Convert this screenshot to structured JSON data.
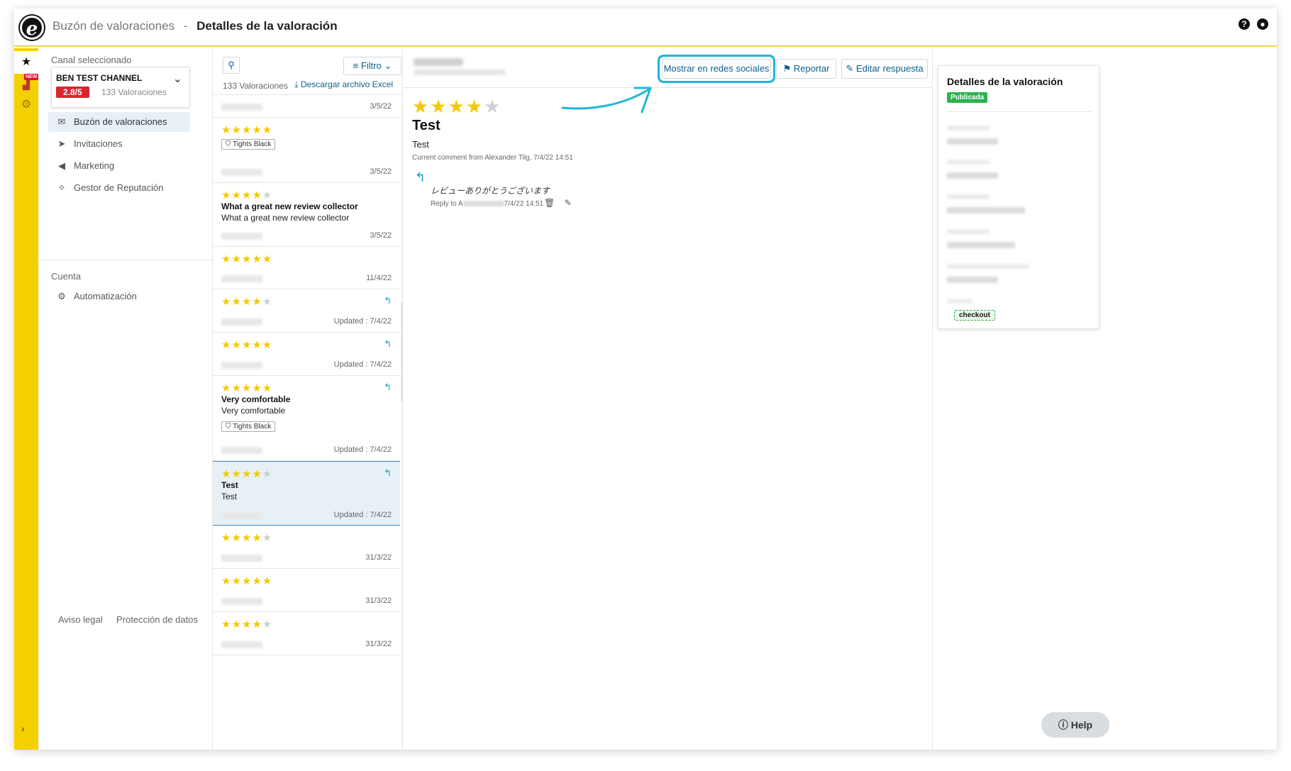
{
  "header": {
    "logo_letter": "e",
    "breadcrumb_parent": "Buzón de valoraciones",
    "breadcrumb_separator": "-",
    "breadcrumb_current": "Detalles de la valoración",
    "help_icon": "question-circle-icon",
    "user_icon": "user-circle-icon"
  },
  "rail": {
    "new_badge": "NEW",
    "items": [
      {
        "icon": "star-icon",
        "active": true
      },
      {
        "icon": "chart-new-icon",
        "active": false
      },
      {
        "icon": "gear-icon",
        "active": false
      }
    ]
  },
  "sidebar": {
    "channel_label": "Canal seleccionado",
    "channel_name": "BEN TEST CHANNEL",
    "rating": "2.8/5",
    "rating_count": "133 Valoraciones",
    "nav": [
      {
        "label": "Buzón de valoraciones",
        "icon": "inbox-icon",
        "active": true
      },
      {
        "label": "Invitaciones",
        "icon": "send-icon",
        "active": false
      },
      {
        "label": "Marketing",
        "icon": "megaphone-icon",
        "active": false
      },
      {
        "label": "Gestor de Reputación",
        "icon": "sparkle-icon",
        "active": false
      }
    ],
    "account_label": "Cuenta",
    "account_nav": [
      {
        "label": "Automatización",
        "icon": "robot-icon"
      }
    ],
    "footer_legal": "Aviso legal",
    "footer_privacy": "Protección de datos"
  },
  "list": {
    "filter_label": "Filtro",
    "count": "133 Valoraciones",
    "excel_label": "Descargar archivo Excel",
    "reviews": [
      {
        "stars": 0,
        "title": "",
        "body": "",
        "tag": "",
        "date": "3/5/22",
        "replied": false
      },
      {
        "stars": 5,
        "title": "",
        "body": "",
        "tag": "Tights Black",
        "date": "3/5/22",
        "replied": false
      },
      {
        "stars": 4,
        "title": "What a great new review collector",
        "body": "What a great new review collector",
        "tag": "",
        "date": "3/5/22",
        "replied": false
      },
      {
        "stars": 5,
        "title": "",
        "body": "",
        "tag": "",
        "date": "11/4/22",
        "replied": false
      },
      {
        "stars": 4,
        "title": "",
        "body": "",
        "tag": "",
        "date": "Updated : 7/4/22",
        "replied": true
      },
      {
        "stars": 5,
        "title": "",
        "body": "",
        "tag": "",
        "date": "Updated : 7/4/22",
        "replied": true
      },
      {
        "stars": 5,
        "title": "Very comfortable",
        "body": "Very comfortable",
        "tag": "Tights Black",
        "date": "Updated : 7/4/22",
        "replied": true
      },
      {
        "stars": 4,
        "title": "Test",
        "body": "Test",
        "tag": "",
        "date": "Updated : 7/4/22",
        "replied": true,
        "selected": true
      },
      {
        "stars": 4,
        "title": "",
        "body": "",
        "tag": "",
        "date": "31/3/22",
        "replied": false
      },
      {
        "stars": 5,
        "title": "",
        "body": "",
        "tag": "",
        "date": "31/3/22",
        "replied": false
      },
      {
        "stars": 4,
        "title": "",
        "body": "",
        "tag": "",
        "date": "31/3/22",
        "replied": false
      }
    ]
  },
  "detail": {
    "btn_social": "Mostrar en redes sociales",
    "btn_report": "Reportar",
    "btn_edit": "Editar respuesta",
    "stars": 4,
    "title": "Test",
    "body": "Test",
    "meta": "Current comment from Alexander Tilg, 7/4/22 14:51",
    "reply_text": "レビューありがとうございます",
    "reply_meta_prefix": "Reply to A",
    "reply_meta_time": "7/4/22 14:51"
  },
  "info": {
    "title": "Detalles de la valoración",
    "status": "Publicada",
    "tag": "checkout"
  },
  "help_label": "Help",
  "colors": {
    "brand_yellow": "#f5d000",
    "accent_blue": "#0b5f8f",
    "highlight_cyan": "#1fb6d8",
    "rating_red": "#d9252f",
    "status_green": "#2eb24f",
    "star_gold": "#f5c800"
  }
}
